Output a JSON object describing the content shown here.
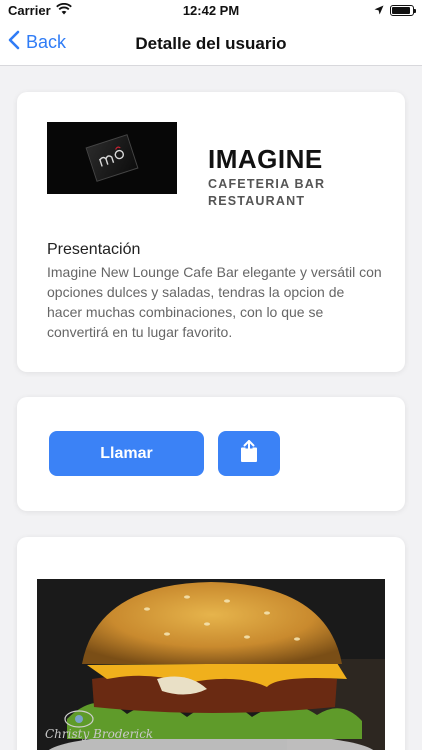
{
  "status_bar": {
    "carrier": "Carrier",
    "time": "12:42 PM",
    "battery_level": 0.9
  },
  "nav": {
    "back_label": "Back",
    "title": "Detalle del usuario"
  },
  "profile": {
    "name": "IMAGINE",
    "category": "CAFETERIA BAR RESTAURANT",
    "section_title": "Presentación",
    "description": "Imagine New Lounge Cafe Bar elegante y versátil con opciones dulces y saladas, tendras la opcion de hacer muchas combinaciones, con lo que se convertirá en tu lugar favorito."
  },
  "actions": {
    "call_label": "Llamar"
  },
  "photo": {
    "watermark": "Christy Broderick"
  },
  "colors": {
    "accent": "#3b82f6",
    "link": "#2f7cf6",
    "background": "#f2f2f4"
  },
  "icons": [
    "wifi-icon",
    "location-arrow-icon",
    "battery-icon",
    "chevron-left-icon",
    "share-icon"
  ]
}
